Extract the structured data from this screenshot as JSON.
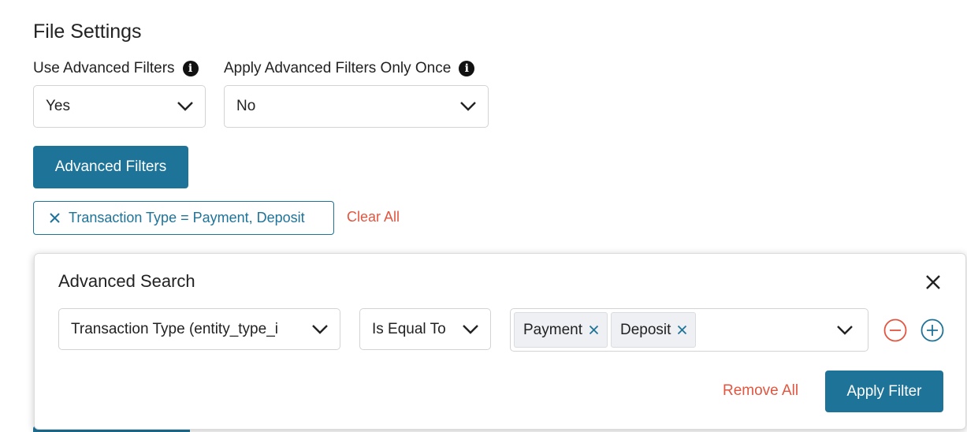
{
  "settings": {
    "title": "File Settings",
    "use_advanced_filters": {
      "label": "Use Advanced Filters",
      "value": "Yes"
    },
    "apply_once": {
      "label": "Apply Advanced Filters Only Once",
      "value": "No"
    },
    "advanced_filters_button": "Advanced Filters"
  },
  "active_filters": {
    "chips": [
      {
        "label": "Transaction Type = Payment, Deposit"
      }
    ],
    "clear_all": "Clear All"
  },
  "advanced_search": {
    "title": "Advanced Search",
    "rows": [
      {
        "field": "Transaction Type (entity_type_i",
        "operator": "Is Equal To",
        "values": [
          "Payment",
          "Deposit"
        ]
      }
    ],
    "remove_all": "Remove All",
    "apply_filter": "Apply Filter"
  },
  "colors": {
    "primary": "#1e7398",
    "danger": "#e2553f",
    "border": "#d3d3d3"
  }
}
